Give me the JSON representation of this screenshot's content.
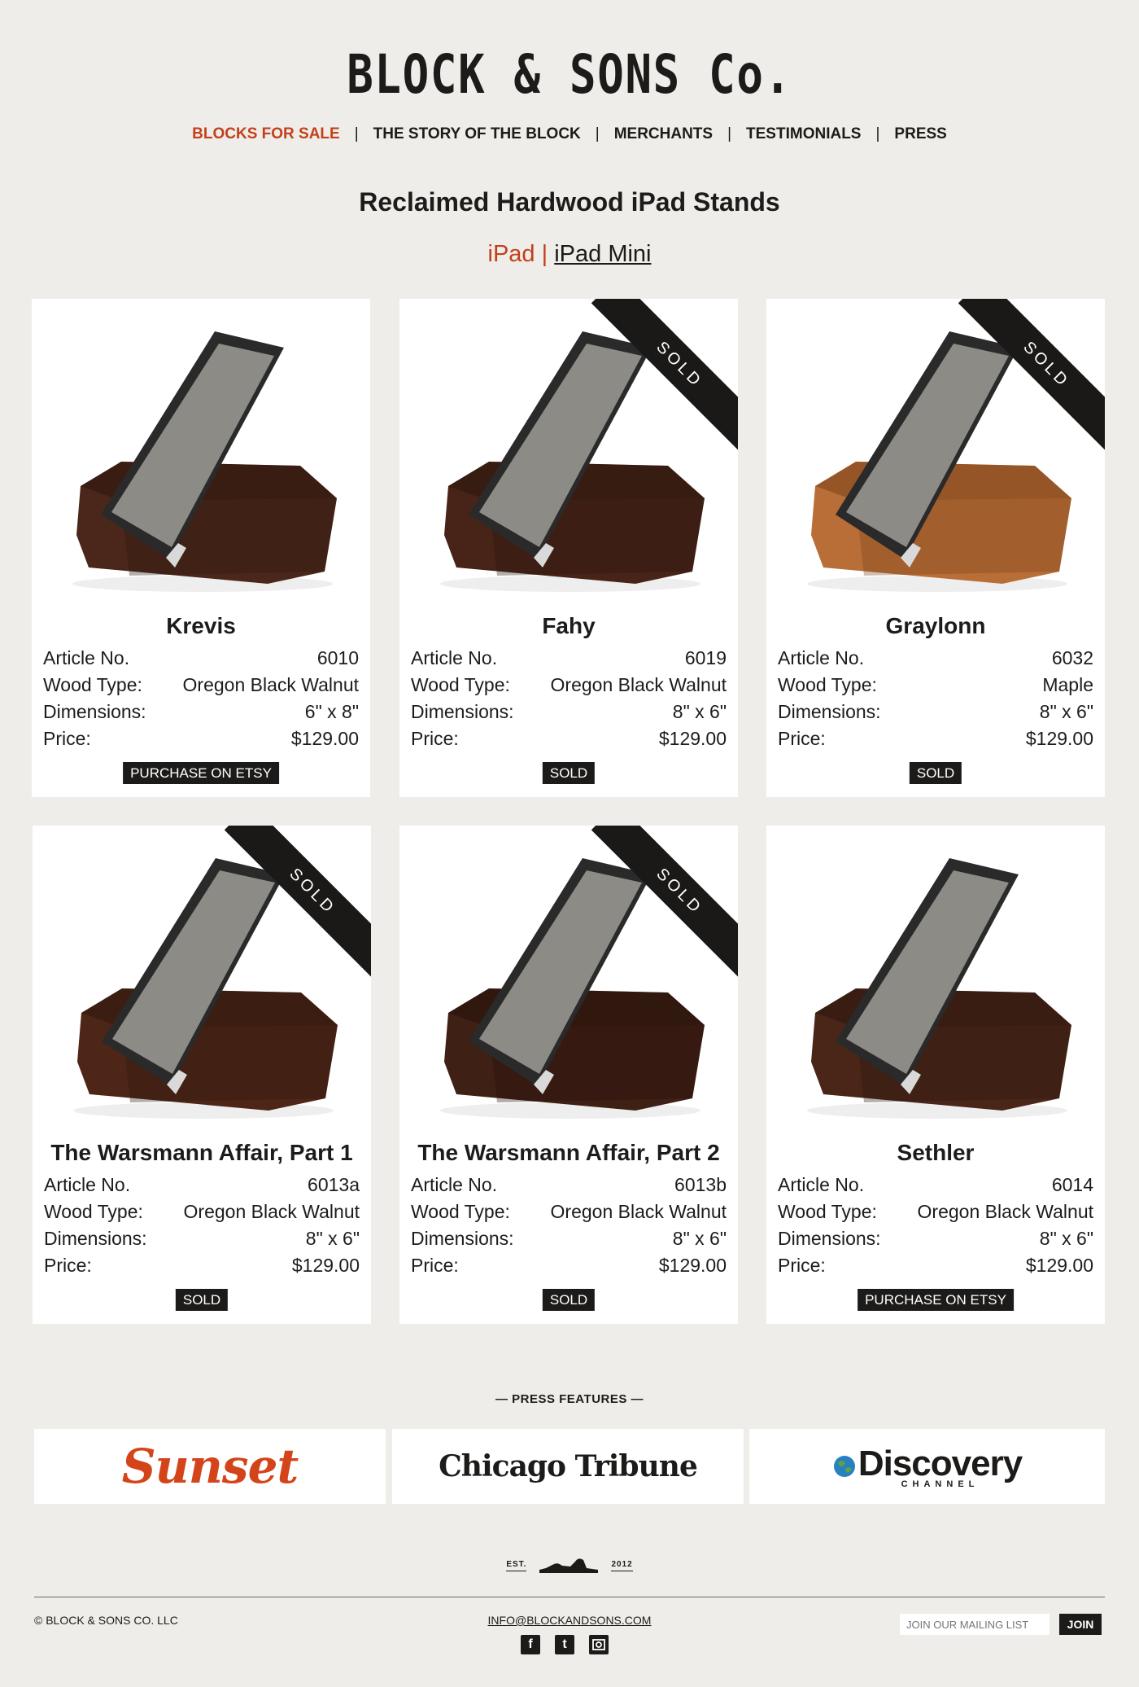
{
  "brand": {
    "logo_text": "BLOCK & SONS Co."
  },
  "nav": {
    "items": [
      {
        "label": "BLOCKS FOR SALE"
      },
      {
        "label": "THE STORY OF THE BLOCK"
      },
      {
        "label": "MERCHANTS"
      },
      {
        "label": "TESTIMONIALS"
      },
      {
        "label": "PRESS"
      }
    ],
    "separator": "|"
  },
  "page": {
    "title": "Reclaimed Hardwood iPad Stands",
    "subnav": {
      "current": "iPad",
      "separator": "|",
      "other": "iPad Mini"
    }
  },
  "labels": {
    "article": "Article No.",
    "wood": "Wood Type:",
    "dimensions": "Dimensions:",
    "price": "Price:",
    "sold_ribbon": "SOLD"
  },
  "products": [
    {
      "name": "Krevis",
      "article": "6010",
      "wood": "Oregon Black Walnut",
      "dimensions": "6\" x 8\"",
      "price": "$129.00",
      "button": "PURCHASE ON ETSY",
      "sold": false,
      "wood_color": "#4a271a",
      "wood_dark": "#2c160f"
    },
    {
      "name": "Fahy",
      "article": "6019",
      "wood": "Oregon Black Walnut",
      "dimensions": "8\" x 6\"",
      "price": "$129.00",
      "button": "SOLD",
      "sold": true,
      "wood_color": "#472417",
      "wood_dark": "#2a150d"
    },
    {
      "name": "Graylonn",
      "article": "6032",
      "wood": "Maple",
      "dimensions": "8\" x 6\"",
      "price": "$129.00",
      "button": "SOLD",
      "sold": true,
      "wood_color": "#b86e36",
      "wood_dark": "#7a421c"
    },
    {
      "name": "The Warsmann Affair, Part 1",
      "article": "6013a",
      "wood": "Oregon Black Walnut",
      "dimensions": "8\" x 6\"",
      "price": "$129.00",
      "button": "SOLD",
      "sold": true,
      "wood_color": "#4d2617",
      "wood_dark": "#2d160e"
    },
    {
      "name": "The Warsmann Affair, Part 2",
      "article": "6013b",
      "wood": "Oregon Black Walnut",
      "dimensions": "8\" x 6\"",
      "price": "$129.00",
      "button": "SOLD",
      "sold": true,
      "wood_color": "#3f2015",
      "wood_dark": "#24120b"
    },
    {
      "name": "Sethler",
      "article": "6014",
      "wood": "Oregon Black Walnut",
      "dimensions": "8\" x 6\"",
      "price": "$129.00",
      "button": "PURCHASE ON ETSY",
      "sold": false,
      "wood_color": "#4a2619",
      "wood_dark": "#2b160f"
    }
  ],
  "press": {
    "heading": "— PRESS FEATURES —",
    "logos": [
      {
        "text": "Sunset"
      },
      {
        "text": "Chicago Tribune"
      },
      {
        "text": "Discovery",
        "sub": "CHANNEL"
      }
    ]
  },
  "footer": {
    "est_label": "EST.",
    "est_year": "2012",
    "copyright": "© BLOCK & SONS CO. LLC",
    "email": "INFO@BLOCKANDSONS.COM",
    "mailing_placeholder": "JOIN OUR MAILING LIST",
    "join_label": "JOIN",
    "social": [
      "facebook-icon",
      "twitter-icon",
      "instagram-icon"
    ]
  },
  "colors": {
    "accent": "#c2401a",
    "background": "#efede9",
    "ink": "#1d1b19"
  }
}
